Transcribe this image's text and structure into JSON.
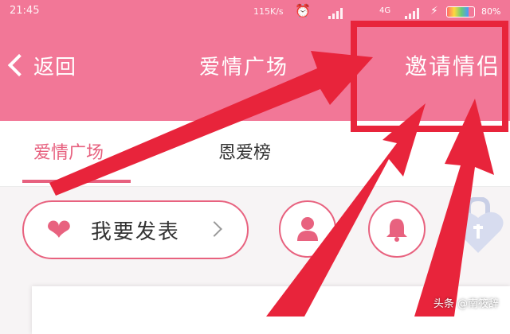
{
  "status_bar": {
    "time": "21:45",
    "net_speed": "115K/s",
    "network": "4G",
    "battery": "80%",
    "battery_level": 0.8,
    "icons": [
      "alarm-icon",
      "signal-icon",
      "signal-icon",
      "charging-icon",
      "battery-icon"
    ]
  },
  "nav": {
    "back_label": "返回",
    "title": "爱情广场",
    "invite_label": "邀请情侣"
  },
  "tabs": [
    {
      "label": "爱情广场",
      "active": true
    },
    {
      "label": "恩爱榜",
      "active": false
    }
  ],
  "actions": {
    "post_label": "我要发表",
    "icons": [
      "heart-icon",
      "chevron-right-icon",
      "user-icon",
      "bell-icon",
      "heart-lock-icon"
    ]
  },
  "watermark": "头条 @南筱辞",
  "colors": {
    "header_bg": "#f27797",
    "accent": "#e7617f",
    "annotation_red": "#e8243b"
  }
}
